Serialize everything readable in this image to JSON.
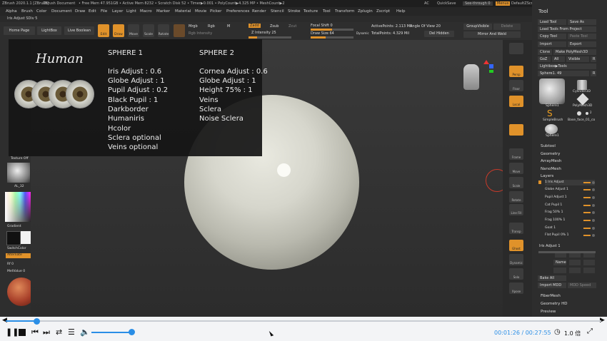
{
  "titlebar": {
    "app": "ZBrush 2020.1.1 [ZBrush]",
    "doc": "ZBrush Document",
    "stats": "• Free Mem 47.951GB • Active Mem 8232 • Scratch Disk 52 • Timer▶0.001 • PolyCount▶4.325 MP • MeshCount▶2",
    "ac": "AC",
    "quicksave": "QuickSave",
    "seethrough": "See-through 0",
    "menus": "Menus",
    "defaultzscript": "DefaultZScript"
  },
  "menubar": [
    "Alpha",
    "Brush",
    "Color",
    "Document",
    "Draw",
    "Edit",
    "File",
    "Layer",
    "Light",
    "Macro",
    "Marker",
    "Material",
    "Movie",
    "Picker",
    "Preferences",
    "Render",
    "Stencil",
    "Stroke",
    "Texture",
    "Tool",
    "Transform",
    "Zplugin",
    "Zscript",
    "Help"
  ],
  "infoline": "Iris Adjust SDiv 5",
  "toolbar": {
    "homepage": "Home Page",
    "lightbox": "LightBox",
    "liveboolean": "Live Boolean",
    "edit": "Edit",
    "draw": "Draw",
    "move": "Move",
    "scale": "Scale",
    "rotate": "Rotate",
    "mrgb": "Mrgb",
    "rgb": "Rgb",
    "m": "M",
    "rgb_intensity": "Rgb Intensity",
    "zadd": "Zadd",
    "zsub": "Zsub",
    "zcut": "Zcut",
    "z_intensity": "Z Intensity 25",
    "focal_shift": "Focal Shift 0",
    "draw_size": "Draw Size 64",
    "dynamic": "Dynamic",
    "active_points": "ActivePoints: 2.113 Mil",
    "total_points": "TotalPoints: 4.329 Mil",
    "angle_of_view": "Angle Of View 20",
    "del_hidden": "Del Hidden",
    "group_visible": "GroupVisible",
    "delete": "Delete",
    "mirror_weld": "Mirror And Weld"
  },
  "overlay": {
    "title": "Human",
    "col1_header": "SPHERE 1",
    "col1_items": [
      "Iris Adjust : 0.6",
      "Globe Adjust : 1",
      "Pupil Adjust : 0.2",
      "Black Pupil : 1",
      "Darkborder",
      "Humaniris",
      "Hcolor",
      "Sclera optional",
      "Veins optional"
    ],
    "col2_header": "SPHERE 2",
    "col2_items": [
      "Cornea Adjust : 0.6",
      "Globe Adjust : 1",
      "Height 75% : 1",
      "Veins",
      "Sclera",
      "Noise Sclera"
    ]
  },
  "leftpanel": {
    "texture_off": "Texture Off",
    "alpha": "AL_32",
    "gradient": "Gradient",
    "switchcolor": "SwitchColor",
    "alternate": "Alternate",
    "rf": "Rf 0",
    "metvalue": "MetValue 0"
  },
  "shelf": [
    "Persp",
    "Floor",
    "Local",
    "Frame",
    "Move",
    "Scale",
    "Rotate",
    "Line Fill",
    "Transp",
    "Ghost",
    "Dynamic",
    "Solo",
    "Xpose"
  ],
  "toolpanel": {
    "title": "Tool",
    "load_tool": "Load Tool",
    "save_as": "Save As",
    "load_tools_project": "Load Tools From Project",
    "copy_tool": "Copy Tool",
    "paste_tool": "Paste Tool",
    "import": "Import",
    "export": "Export",
    "clone": "Clone",
    "make_polymesh": "Make PolyMesh3D",
    "goz": "GoZ",
    "all": "All",
    "visible": "Visible",
    "r": "R",
    "lightbox_tools": "Lightbox▶Tools",
    "current_tool": "Sphere1. 49",
    "r2": "R",
    "thumbs": [
      "Sphere1",
      "Cylinder3D",
      "PolyMesh3D",
      "SimpleBrush",
      "Base_face_01_co",
      "Sphere1"
    ],
    "thumb_count": "2",
    "subtool": "Subtool",
    "geometry": "Geometry",
    "arraymesh": "ArrayMesh",
    "nanomesh": "NanoMesh",
    "layers_label": "Layers",
    "layers": [
      "1 Iris Adjust",
      "Globe Adjust 1",
      "Pupil Adjust 1",
      "Cat Pupil 1",
      "Frag 50% 1",
      "Frag 100% 1",
      "Goat 1",
      "Flat Pupil 0% 1"
    ],
    "iris_adjust": "Iris Adjust 1",
    "name": "Name",
    "bake_all": "Bake All",
    "import_mdd": "Import MDD",
    "mdd_speed": "MDD Speed",
    "fibermesh": "FiberMesh",
    "geometry_hd": "Geometry HD",
    "preview": "Preview"
  },
  "player": {
    "time": "00:01:26 / 00:27:55",
    "speed": "1.0 倍",
    "progress": 0.052,
    "volume": 0.85
  }
}
